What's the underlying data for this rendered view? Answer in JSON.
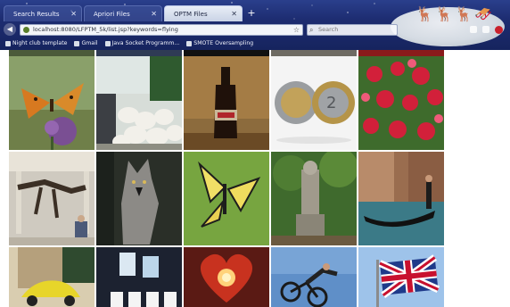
{
  "browser": {
    "tabs": [
      {
        "label": "Search Results",
        "active": false
      },
      {
        "label": "Apriori Files",
        "active": false
      },
      {
        "label": "OPTM Files",
        "active": true
      }
    ],
    "new_tab": "+",
    "url": "localhost:8080/LFPTM_5k/list.jsp?keywords=flying",
    "search_placeholder": "Search",
    "bookmarks": [
      "Night club template",
      "Gmail",
      "Java Socket Programm...",
      "SMOTE Oversampling"
    ]
  },
  "images": [
    {
      "name": "butterfly-on-thistle"
    },
    {
      "name": "sheep-flock"
    },
    {
      "name": "cola-bottle"
    },
    {
      "name": "euro-coins"
    },
    {
      "name": "red-flowers"
    },
    {
      "name": "dinosaur-skeleton"
    },
    {
      "name": "wolf"
    },
    {
      "name": "swallowtail-butterfly"
    },
    {
      "name": "garden-statue"
    },
    {
      "name": "venice-gondola"
    },
    {
      "name": "yellow-car-street"
    },
    {
      "name": "playing-cards"
    },
    {
      "name": "candle-heart"
    },
    {
      "name": "bmx-rider"
    },
    {
      "name": "union-flag"
    }
  ],
  "colors": {
    "chrome_top": "#2a3f8c",
    "chrome_bottom": "#16245e",
    "active_tab": "#e9eef7"
  }
}
